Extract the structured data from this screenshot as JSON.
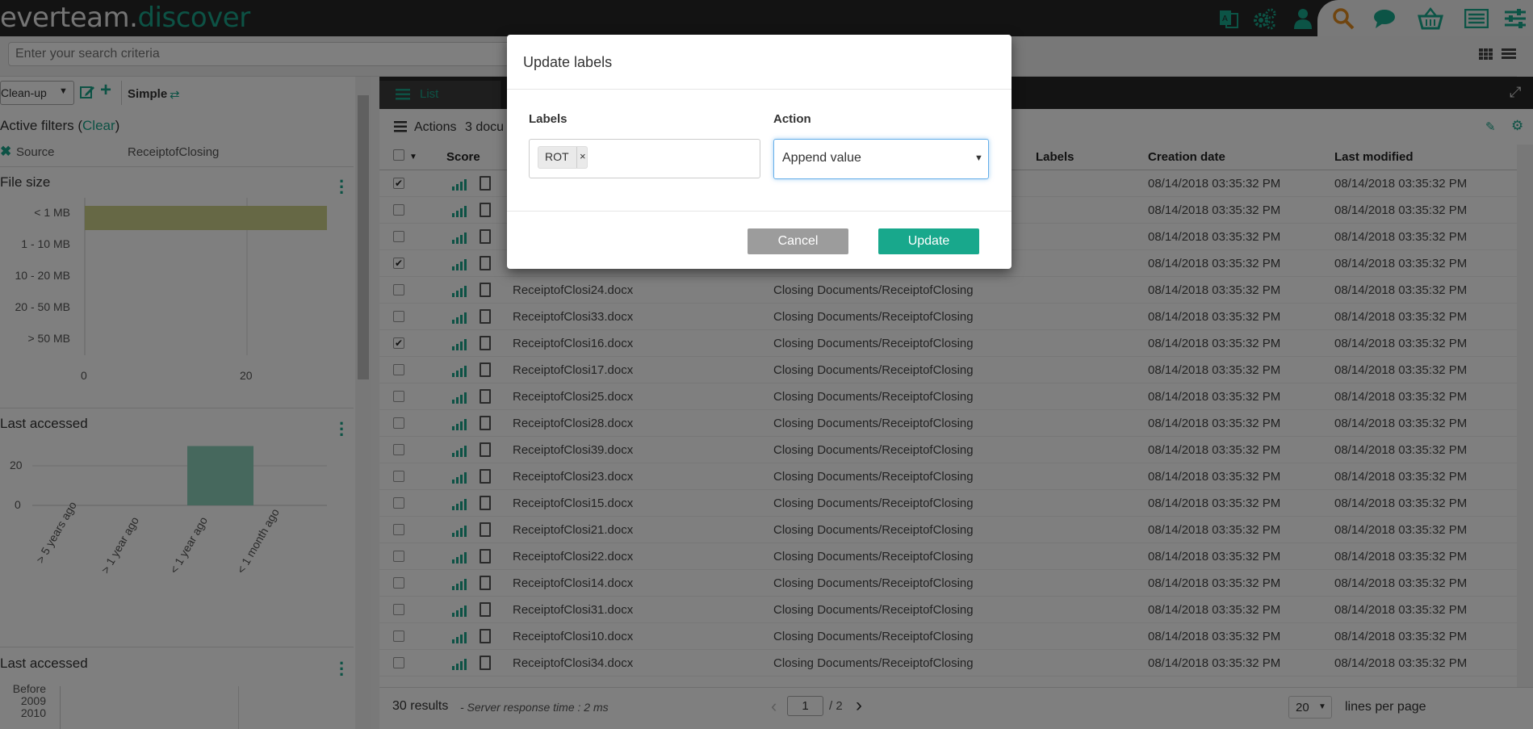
{
  "app": {
    "logo_part1": "everteam.",
    "logo_part2": "discover"
  },
  "icons": {
    "translate": "translate-icon",
    "settings": "gears-icon",
    "user": "user-icon",
    "search": "search-icon",
    "chat": "chat-icon",
    "basket": "basket-icon",
    "list": "list-view-icon",
    "sliders": "sliders-icon",
    "grid": "grid-icon"
  },
  "search": {
    "placeholder": "Enter your search criteria"
  },
  "left": {
    "view_select": "Clean-up",
    "simple_label": "Simple",
    "active_filters_label": "Active filters (",
    "clear_label": "Clear",
    "active_filters_close": ")",
    "filter_key": "Source",
    "filter_value": "ReceiptofClosing",
    "file_size": {
      "title": "File size",
      "categories": [
        "< 1 MB",
        "1 - 10 MB",
        "10 - 20 MB",
        "20 - 50 MB",
        "> 50 MB"
      ],
      "ticks": [
        "0",
        "20"
      ]
    },
    "last_accessed": {
      "title": "Last accessed",
      "yticks": [
        "20",
        "0"
      ],
      "categories": [
        "> 5 years ago",
        "> 1 year ago",
        "< 1 year ago",
        "< 1 month ago"
      ]
    },
    "last_accessed2": {
      "title": "Last accessed",
      "labels": [
        "Before",
        "2009",
        "2010"
      ]
    }
  },
  "chart_data": [
    {
      "type": "bar",
      "title": "File size",
      "categories": [
        "< 1 MB",
        "1 - 10 MB",
        "10 - 20 MB",
        "20 - 50 MB",
        "> 50 MB"
      ],
      "values": [
        30,
        0,
        0,
        0,
        0
      ],
      "xlim": [
        0,
        30
      ]
    },
    {
      "type": "bar",
      "title": "Last accessed",
      "categories": [
        "> 5 years ago",
        "> 1 year ago",
        "< 1 year ago",
        "< 1 month ago"
      ],
      "values": [
        0,
        0,
        30,
        0
      ],
      "ylim": [
        0,
        30
      ]
    }
  ],
  "main": {
    "tab_label": "List",
    "actions_label": "Actions",
    "docs_label": "3 docu",
    "columns": {
      "score": "Score",
      "labels": "Labels",
      "creation": "Creation date",
      "modified": "Last modified"
    },
    "rows": [
      {
        "name": "",
        "path": "",
        "created": "08/14/2018 03:35:32 PM",
        "modified": "08/14/2018 03:35:32 PM",
        "checked": true
      },
      {
        "name": "",
        "path": "",
        "created": "08/14/2018 03:35:32 PM",
        "modified": "08/14/2018 03:35:32 PM",
        "checked": false
      },
      {
        "name": "",
        "path": "",
        "created": "08/14/2018 03:35:32 PM",
        "modified": "08/14/2018 03:35:32 PM",
        "checked": false
      },
      {
        "name": "",
        "path": "",
        "created": "08/14/2018 03:35:32 PM",
        "modified": "08/14/2018 03:35:32 PM",
        "checked": true
      },
      {
        "name": "ReceiptofClosi24.docx",
        "path": "Closing Documents/ReceiptofClosing",
        "created": "08/14/2018 03:35:32 PM",
        "modified": "08/14/2018 03:35:32 PM",
        "checked": false
      },
      {
        "name": "ReceiptofClosi33.docx",
        "path": "Closing Documents/ReceiptofClosing",
        "created": "08/14/2018 03:35:32 PM",
        "modified": "08/14/2018 03:35:32 PM",
        "checked": false
      },
      {
        "name": "ReceiptofClosi16.docx",
        "path": "Closing Documents/ReceiptofClosing",
        "created": "08/14/2018 03:35:32 PM",
        "modified": "08/14/2018 03:35:32 PM",
        "checked": true
      },
      {
        "name": "ReceiptofClosi17.docx",
        "path": "Closing Documents/ReceiptofClosing",
        "created": "08/14/2018 03:35:32 PM",
        "modified": "08/14/2018 03:35:32 PM",
        "checked": false
      },
      {
        "name": "ReceiptofClosi25.docx",
        "path": "Closing Documents/ReceiptofClosing",
        "created": "08/14/2018 03:35:32 PM",
        "modified": "08/14/2018 03:35:32 PM",
        "checked": false
      },
      {
        "name": "ReceiptofClosi28.docx",
        "path": "Closing Documents/ReceiptofClosing",
        "created": "08/14/2018 03:35:32 PM",
        "modified": "08/14/2018 03:35:32 PM",
        "checked": false
      },
      {
        "name": "ReceiptofClosi39.docx",
        "path": "Closing Documents/ReceiptofClosing",
        "created": "08/14/2018 03:35:32 PM",
        "modified": "08/14/2018 03:35:32 PM",
        "checked": false
      },
      {
        "name": "ReceiptofClosi23.docx",
        "path": "Closing Documents/ReceiptofClosing",
        "created": "08/14/2018 03:35:32 PM",
        "modified": "08/14/2018 03:35:32 PM",
        "checked": false
      },
      {
        "name": "ReceiptofClosi15.docx",
        "path": "Closing Documents/ReceiptofClosing",
        "created": "08/14/2018 03:35:32 PM",
        "modified": "08/14/2018 03:35:32 PM",
        "checked": false
      },
      {
        "name": "ReceiptofClosi21.docx",
        "path": "Closing Documents/ReceiptofClosing",
        "created": "08/14/2018 03:35:32 PM",
        "modified": "08/14/2018 03:35:32 PM",
        "checked": false
      },
      {
        "name": "ReceiptofClosi22.docx",
        "path": "Closing Documents/ReceiptofClosing",
        "created": "08/14/2018 03:35:32 PM",
        "modified": "08/14/2018 03:35:32 PM",
        "checked": false
      },
      {
        "name": "ReceiptofClosi14.docx",
        "path": "Closing Documents/ReceiptofClosing",
        "created": "08/14/2018 03:35:32 PM",
        "modified": "08/14/2018 03:35:32 PM",
        "checked": false
      },
      {
        "name": "ReceiptofClosi31.docx",
        "path": "Closing Documents/ReceiptofClosing",
        "created": "08/14/2018 03:35:32 PM",
        "modified": "08/14/2018 03:35:32 PM",
        "checked": false
      },
      {
        "name": "ReceiptofClosi10.docx",
        "path": "Closing Documents/ReceiptofClosing",
        "created": "08/14/2018 03:35:32 PM",
        "modified": "08/14/2018 03:35:32 PM",
        "checked": false
      },
      {
        "name": "ReceiptofClosi34.docx",
        "path": "Closing Documents/ReceiptofClosing",
        "created": "08/14/2018 03:35:32 PM",
        "modified": "08/14/2018 03:35:32 PM",
        "checked": false
      }
    ]
  },
  "footer": {
    "results": "30 results",
    "response": "- Server response time : 2 ms",
    "page_value": "1",
    "page_total": "/ 2",
    "lines_value": "20",
    "lines_label": "lines per page"
  },
  "modal": {
    "title": "Update labels",
    "labels_heading": "Labels",
    "action_heading": "Action",
    "chip": "ROT",
    "chip_remove": "×",
    "action_value": "Append value",
    "cancel": "Cancel",
    "update": "Update"
  }
}
